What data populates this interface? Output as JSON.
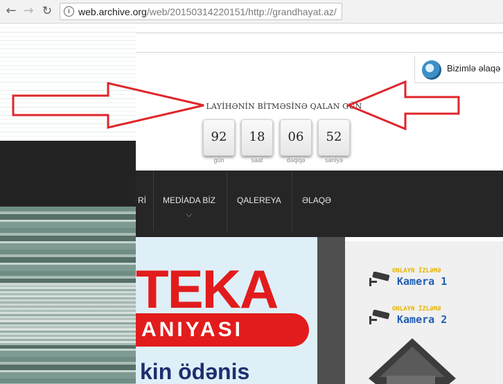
{
  "browser": {
    "url_host": "web.archive.org",
    "url_path": "/web/20150314220151/http://grandhayat.az/",
    "back_glyph": "←",
    "forward_glyph": "→",
    "reload_glyph": "↻",
    "info_glyph": "i"
  },
  "header": {
    "contact_label": "Bizimlə əlaqə",
    "countdown_title": "LAYİHƏNİN BİTMƏSİNƏ QALAN GÜN",
    "countdown": [
      {
        "value": "92",
        "label": "gün"
      },
      {
        "value": "18",
        "label": "saat"
      },
      {
        "value": "06",
        "label": "dəqiqə"
      },
      {
        "value": "52",
        "label": "saniyə"
      }
    ]
  },
  "menu": {
    "partial_item": "Rİ",
    "items": [
      "MEDİADA BİZ",
      "QALEREYA",
      "ƏLAQƏ"
    ],
    "chevron": "⌵"
  },
  "banner": {
    "line1": "TEKA",
    "line2": "ANIYASI",
    "line3": "kin ödənis"
  },
  "sidebar": {
    "cameras": [
      {
        "caption": "ONLAYN İZLƏMƏ",
        "name": "Kamera 1"
      },
      {
        "caption": "ONLAYN İZLƏMƏ",
        "name": "Kamera 2"
      }
    ]
  },
  "colors": {
    "annotation_arrow": "#e0262b",
    "menu_bg": "#262626",
    "banner_red": "#e21c1c",
    "camera_blue": "#1f5fb3",
    "camera_yellow": "#e6b400"
  }
}
